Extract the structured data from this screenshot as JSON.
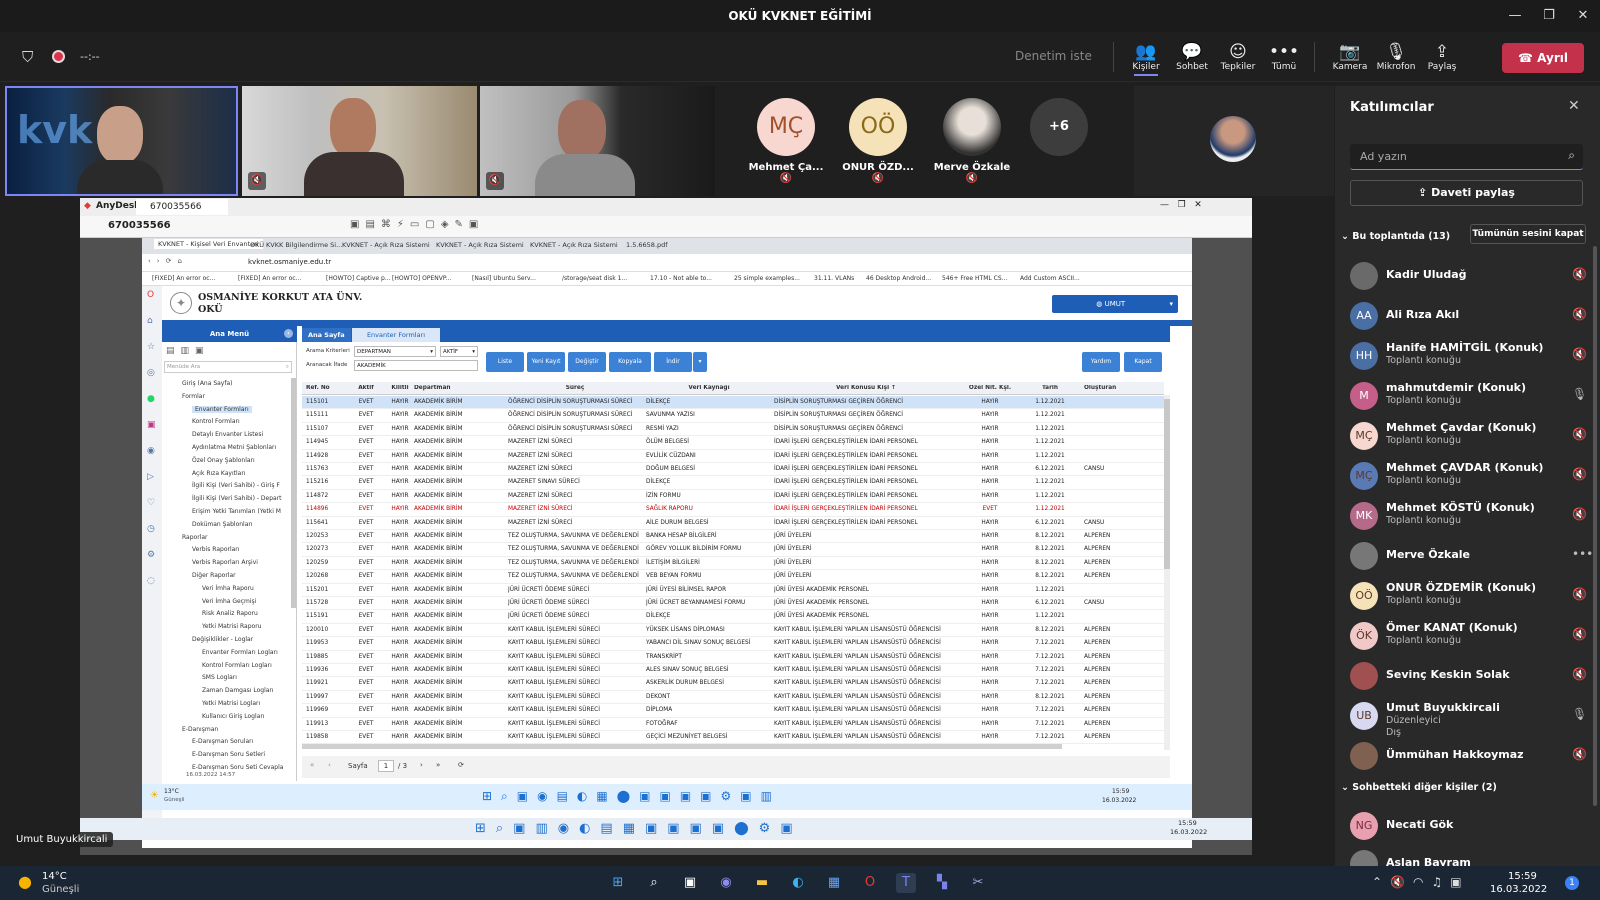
{
  "window": {
    "title": "OKÜ KVKNET EĞİTİMİ"
  },
  "meeting": {
    "timer": "--:--",
    "ask_control": "Denetim iste",
    "tools": [
      "Kişiler",
      "Sohbet",
      "Tepkiler",
      "Tümü",
      "Kamera",
      "Mikrofon",
      "Paylaş"
    ],
    "leave_label": "Ayrıl",
    "avatars": [
      {
        "initials": "MÇ",
        "name": "Mehmet Ça...",
        "color": "#f7d7cf",
        "fg": "#a0522d"
      },
      {
        "initials": "OÖ",
        "name": "ONUR ÖZD...",
        "color": "#f5e2b8",
        "fg": "#8a6a1a"
      },
      {
        "initials": "",
        "name": "Merve Özkale",
        "color": "#888888",
        "fg": "#ffffff"
      }
    ],
    "more_count": "+6",
    "presenter_label": "Umut Buyukkircali"
  },
  "panel": {
    "title": "Katılımcılar",
    "search_placeholder": "Ad yazın",
    "share_invite": "Daveti paylaş",
    "in_meeting": "Bu toplantıda (13)",
    "mute_all": "Tümünün sesini kapat",
    "others": "Sohbetteki diğer kişiler (2)",
    "participants": [
      {
        "initials": "",
        "name": "Kadir Uludağ",
        "sub": "",
        "color": "#6a6a6a"
      },
      {
        "initials": "AA",
        "name": "Ali Rıza Akıl",
        "sub": "",
        "color": "#4a6fa5"
      },
      {
        "initials": "HH",
        "name": "Hanife HAMİTGİL (Konuk)",
        "sub": "Toplantı konuğu",
        "color": "#4a6fa5"
      },
      {
        "initials": "M",
        "name": "mahmutdemir (Konuk)",
        "sub": "Toplantı konuğu",
        "color": "#c55f8a"
      },
      {
        "initials": "MÇ",
        "name": "Mehmet Çavdar (Konuk)",
        "sub": "Toplantı konuğu",
        "color": "#f7d7cf"
      },
      {
        "initials": "MÇ",
        "name": "Mehmet ÇAVDAR (Konuk)",
        "sub": "Toplantı konuğu",
        "color": "#5a7ab5"
      },
      {
        "initials": "MK",
        "name": "Mehmet KÖSTÜ (Konuk)",
        "sub": "Toplantı konuğu",
        "color": "#b56a8a"
      },
      {
        "initials": "",
        "name": "Merve Özkale",
        "sub": "",
        "color": "#777777"
      },
      {
        "initials": "OÖ",
        "name": "ONUR ÖZDEMİR (Konuk)",
        "sub": "Toplantı konuğu",
        "color": "#f5e2b8"
      },
      {
        "initials": "ÖK",
        "name": "Ömer KANAT (Konuk)",
        "sub": "Toplantı konuğu",
        "color": "#f0c8c8"
      },
      {
        "initials": "",
        "name": "Sevinç Keskin Solak",
        "sub": "",
        "color": "#a05050"
      },
      {
        "initials": "UB",
        "name": "Umut Buyukkircali",
        "sub": "Düzenleyici",
        "sub2": "Dış",
        "color": "#d8d8f0"
      },
      {
        "initials": "",
        "name": "Ümmühan Hakkoymaz",
        "sub": "",
        "color": "#806050"
      }
    ],
    "others_list": [
      {
        "initials": "NG",
        "name": "Necati Gök",
        "color": "#e8a0b0"
      },
      {
        "initials": "",
        "name": "Aslan Bayram",
        "color": "#777777"
      }
    ]
  },
  "anydesk": {
    "title": "AnyDesk",
    "tab": "670035566",
    "address": "670035566"
  },
  "browser": {
    "tabs": [
      "KVKNET - Kişisel Veri Envanteri",
      "OKÜ KVKK Bilgilendirme Si...",
      "KVKNET - Açık Rıza Sistemi",
      "KVKNET - Açık Rıza Sistemi",
      "KVKNET - Açık Rıza Sistemi",
      "1.5.6658.pdf"
    ],
    "url": "kvknet.osmaniye.edu.tr",
    "bookmarks": [
      "[FIXED] An error oc...",
      "[FIXED] An error oc...",
      "[HOWTO] Captive p...",
      "[HOWTO] OPENVP...",
      "[Nasıl] Ubuntu Serv...",
      "/storage/seat disk 1...",
      "17.10 - Not able to...",
      "25 simple examples...",
      "31.11. VLANs",
      "46 Desktop Android...",
      "546+ Free HTML CS...",
      "Add Custom ASCII..."
    ]
  },
  "app": {
    "university": "OSMANİYE KORKUT ATA ÜNV.",
    "abbr": "OKÜ",
    "user_button": "UMUT",
    "menu_title": "Ana Menü",
    "menu_search": "Menüde Ara",
    "menu": [
      "Giriş (Ana Sayfa)",
      "Formlar",
      "Envanter Formları",
      "Kontrol Formları",
      "Detaylı Envanter Listesi",
      "Aydınlatma Metni Şablonları",
      "Özel Onay Şablonları",
      "Açık Rıza Kayıtları",
      "İlgili Kişi (Veri Sahibi) - Giriş F",
      "İlgili Kişi (Veri Sahibi) - Depart",
      "Erişim Yetki Tanımları (Yetki M",
      "Doküman Şablonları",
      "Raporlar",
      "Verbis Raporları",
      "Verbis Raporları Arşivi",
      "Diğer Raporlar",
      "Veri İmha Raporu",
      "Veri İmha Geçmişi",
      "Risk Analiz Raporu",
      "Yetki Matrisi Raporu",
      "Değişiklikler - Loglar",
      "Envanter Formları Logları",
      "Kontrol Formları Logları",
      "SMS Logları",
      "Zaman Damgası Logları",
      "Yetki Matrisi Logları",
      "Kullanıcı Giriş Logları",
      "E-Danışman",
      "E-Danışman Soruları",
      "E-Danışman Soru Setleri",
      "E-Danışman Soru Seti Cevapla"
    ],
    "menu_date": "16.03.2022 14:57",
    "tab_home": "Ana Sayfa",
    "tab_forms": "Envanter Formları",
    "criteria_label": "Arama Kriterleri",
    "criteria_value": "DEPARTMAN",
    "status_value": "AKTİF",
    "search_label": "Aranacak İfade",
    "search_value": "AKADEMİK",
    "buttons": [
      "Liste",
      "Yeni Kayıt",
      "Değiştir",
      "Kopyala",
      "İndir"
    ],
    "help": "Yardım",
    "close": "Kapat",
    "columns": [
      "Ref. No",
      "Aktif",
      "Kilitli",
      "Departman",
      "Süreç",
      "Veri Kaynağı",
      "Veri Konusu Kişi ↑",
      "Özel Nit. Kşl.",
      "Tarih",
      "Oluşturan"
    ],
    "rows": [
      [
        "115101",
        "EVET",
        "HAYIR",
        "AKADEMİK BİRİM",
        "ÖĞRENCİ DİSİPLİN SORUŞTURMASI SÜRECİ",
        "DİLEKÇE",
        "DİSİPLİN SORUŞTURMASI GEÇİREN ÖĞRENCİ",
        "HAYIR",
        "1.12.2021",
        ""
      ],
      [
        "115111",
        "EVET",
        "HAYIR",
        "AKADEMİK BİRİM",
        "ÖĞRENCİ DİSİPLİN SORUŞTURMASI SÜRECİ",
        "SAVUNMA YAZISI",
        "DİSİPLİN SORUŞTURMASI GEÇİREN ÖĞRENCİ",
        "HAYIR",
        "1.12.2021",
        ""
      ],
      [
        "115107",
        "EVET",
        "HAYIR",
        "AKADEMİK BİRİM",
        "ÖĞRENCİ DİSİPLİN SORUŞTURMASI SÜRECİ",
        "RESMİ YAZI",
        "DİSİPLİN SORUŞTURMASI GEÇİREN ÖĞRENCİ",
        "HAYIR",
        "1.12.2021",
        ""
      ],
      [
        "114945",
        "EVET",
        "HAYIR",
        "AKADEMİK BİRİM",
        "MAZERET İZNİ SÜRECİ",
        "ÖLÜM BELGESİ",
        "İDARİ İŞLERİ GERÇEKLEŞTİRİLEN İDARİ PERSONEL",
        "HAYIR",
        "1.12.2021",
        ""
      ],
      [
        "114928",
        "EVET",
        "HAYIR",
        "AKADEMİK BİRİM",
        "MAZERET İZNİ SÜRECİ",
        "EVLİLİK CÜZDANI",
        "İDARİ İŞLERİ GERÇEKLEŞTİRİLEN İDARİ PERSONEL",
        "HAYIR",
        "1.12.2021",
        ""
      ],
      [
        "115763",
        "EVET",
        "HAYIR",
        "AKADEMİK BİRİM",
        "MAZERET İZNİ SÜRECİ",
        "DOĞUM BELGESİ",
        "İDARİ İŞLERİ GERÇEKLEŞTİRİLEN İDARİ PERSONEL",
        "HAYIR",
        "6.12.2021",
        "CANSU"
      ],
      [
        "115216",
        "EVET",
        "HAYIR",
        "AKADEMİK BİRİM",
        "MAZERET SINAVI SÜRECİ",
        "DİLEKÇE",
        "İDARİ İŞLERİ GERÇEKLEŞTİRİLEN İDARİ PERSONEL",
        "HAYIR",
        "1.12.2021",
        ""
      ],
      [
        "114872",
        "EVET",
        "HAYIR",
        "AKADEMİK BİRİM",
        "MAZERET İZNİ SÜRECİ",
        "İZİN FORMU",
        "İDARİ İŞLERİ GERÇEKLEŞTİRİLEN İDARİ PERSONEL",
        "HAYIR",
        "1.12.2021",
        ""
      ],
      [
        "114896",
        "EVET",
        "HAYIR",
        "AKADEMİK BİRİM",
        "MAZERET İZNİ SÜRECİ",
        "SAĞLIK RAPORU",
        "İDARİ İŞLERİ GERÇEKLEŞTİRİLEN İDARİ PERSONEL",
        "EVET",
        "1.12.2021",
        ""
      ],
      [
        "115641",
        "EVET",
        "HAYIR",
        "AKADEMİK BİRİM",
        "MAZERET İZNİ SÜRECİ",
        "AİLE DURUM BELGESİ",
        "İDARİ İŞLERİ GERÇEKLEŞTİRİLEN İDARİ PERSONEL",
        "HAYIR",
        "6.12.2021",
        "CANSU"
      ],
      [
        "120253",
        "EVET",
        "HAYIR",
        "AKADEMİK BİRİM",
        "TEZ OLUŞTURMA, SAVUNMA VE DEĞERLENDİ",
        "BANKA HESAP BİLGİLERİ",
        "JÜRİ ÜYELERİ",
        "HAYIR",
        "8.12.2021",
        "ALPEREN"
      ],
      [
        "120273",
        "EVET",
        "HAYIR",
        "AKADEMİK BİRİM",
        "TEZ OLUŞTURMA, SAVUNMA VE DEĞERLENDİ",
        "GÖREV YOLLUK BİLDİRİM FORMU",
        "JÜRİ ÜYELERİ",
        "HAYIR",
        "8.12.2021",
        "ALPEREN"
      ],
      [
        "120259",
        "EVET",
        "HAYIR",
        "AKADEMİK BİRİM",
        "TEZ OLUŞTURMA, SAVUNMA VE DEĞERLENDİ",
        "İLETİŞİM BİLGİLERİ",
        "JÜRİ ÜYELERİ",
        "HAYIR",
        "8.12.2021",
        "ALPEREN"
      ],
      [
        "120268",
        "EVET",
        "HAYIR",
        "AKADEMİK BİRİM",
        "TEZ OLUŞTURMA, SAVUNMA VE DEĞERLENDİ",
        "VEB BEYAN FORMU",
        "JÜRİ ÜYELERİ",
        "HAYIR",
        "8.12.2021",
        "ALPEREN"
      ],
      [
        "115201",
        "EVET",
        "HAYIR",
        "AKADEMİK BİRİM",
        "JÜRİ ÜCRETİ ÖDEME SÜRECİ",
        "JÜRİ ÜYESİ BİLİMSEL RAPOR",
        "JÜRİ ÜYESİ AKADEMİK PERSONEL",
        "HAYIR",
        "1.12.2021",
        ""
      ],
      [
        "115728",
        "EVET",
        "HAYIR",
        "AKADEMİK BİRİM",
        "JÜRİ ÜCRETİ ÖDEME SÜRECİ",
        "JÜRİ ÜCRET BEYANNAMESİ FORMU",
        "JÜRİ ÜYESİ AKADEMİK PERSONEL",
        "HAYIR",
        "6.12.2021",
        "CANSU"
      ],
      [
        "115191",
        "EVET",
        "HAYIR",
        "AKADEMİK BİRİM",
        "JÜRİ ÜCRETİ ÖDEME SÜRECİ",
        "DİLEKÇE",
        "JÜRİ ÜYESİ AKADEMİK PERSONEL",
        "HAYIR",
        "1.12.2021",
        ""
      ],
      [
        "120010",
        "EVET",
        "HAYIR",
        "AKADEMİK BİRİM",
        "KAYIT KABUL İŞLEMLERİ SÜRECİ",
        "YÜKSEK LİSANS DİPLOMASI",
        "KAYIT KABUL İŞLEMLERİ YAPILAN LİSANSÜSTÜ ÖĞRENCİSİ",
        "HAYIR",
        "8.12.2021",
        "ALPEREN"
      ],
      [
        "119953",
        "EVET",
        "HAYIR",
        "AKADEMİK BİRİM",
        "KAYIT KABUL İŞLEMLERİ SÜRECİ",
        "YABANCI DİL SINAV SONUÇ BELGESİ",
        "KAYIT KABUL İŞLEMLERİ YAPILAN LİSANSÜSTÜ ÖĞRENCİSİ",
        "HAYIR",
        "7.12.2021",
        "ALPEREN"
      ],
      [
        "119885",
        "EVET",
        "HAYIR",
        "AKADEMİK BİRİM",
        "KAYIT KABUL İŞLEMLERİ SÜRECİ",
        "TRANSKRİPT",
        "KAYIT KABUL İŞLEMLERİ YAPILAN LİSANSÜSTÜ ÖĞRENCİSİ",
        "HAYIR",
        "7.12.2021",
        "ALPEREN"
      ],
      [
        "119936",
        "EVET",
        "HAYIR",
        "AKADEMİK BİRİM",
        "KAYIT KABUL İŞLEMLERİ SÜRECİ",
        "ALES SINAV SONUÇ BELGESİ",
        "KAYIT KABUL İŞLEMLERİ YAPILAN LİSANSÜSTÜ ÖĞRENCİSİ",
        "HAYIR",
        "7.12.2021",
        "ALPEREN"
      ],
      [
        "119921",
        "EVET",
        "HAYIR",
        "AKADEMİK BİRİM",
        "KAYIT KABUL İŞLEMLERİ SÜRECİ",
        "ASKERLİK DURUM BELGESİ",
        "KAYIT KABUL İŞLEMLERİ YAPILAN LİSANSÜSTÜ ÖĞRENCİSİ",
        "HAYIR",
        "7.12.2021",
        "ALPEREN"
      ],
      [
        "119997",
        "EVET",
        "HAYIR",
        "AKADEMİK BİRİM",
        "KAYIT KABUL İŞLEMLERİ SÜRECİ",
        "DEKONT",
        "KAYIT KABUL İŞLEMLERİ YAPILAN LİSANSÜSTÜ ÖĞRENCİSİ",
        "HAYIR",
        "8.12.2021",
        "ALPEREN"
      ],
      [
        "119969",
        "EVET",
        "HAYIR",
        "AKADEMİK BİRİM",
        "KAYIT KABUL İŞLEMLERİ SÜRECİ",
        "DİPLOMA",
        "KAYIT KABUL İŞLEMLERİ YAPILAN LİSANSÜSTÜ ÖĞRENCİSİ",
        "HAYIR",
        "7.12.2021",
        "ALPEREN"
      ],
      [
        "119913",
        "EVET",
        "HAYIR",
        "AKADEMİK BİRİM",
        "KAYIT KABUL İŞLEMLERİ SÜRECİ",
        "FOTOĞRAF",
        "KAYIT KABUL İŞLEMLERİ YAPILAN LİSANSÜSTÜ ÖĞRENCİSİ",
        "HAYIR",
        "7.12.2021",
        "ALPEREN"
      ],
      [
        "119858",
        "EVET",
        "HAYIR",
        "AKADEMİK BİRİM",
        "KAYIT KABUL İŞLEMLERİ SÜRECİ",
        "GEÇİCİ MEZUNİYET BELGESİ",
        "KAYIT KABUL İŞLEMLERİ YAPILAN LİSANSÜSTÜ ÖĞRENCİSİ",
        "HAYIR",
        "7.12.2021",
        "ALPEREN"
      ]
    ],
    "pager_label": "Sayfa",
    "pager_page": "1",
    "pager_total": "/ 3"
  },
  "remote_taskbar": {
    "weather": "13°C",
    "weather_sub": "Güneşli",
    "time": "15:59",
    "date": "16.03.2022"
  },
  "inner_taskbar": {
    "time": "15:59",
    "date": "16.03.2022"
  },
  "taskbar": {
    "weather": "14°C",
    "weather_sub": "Güneşli",
    "time": "15:59",
    "date": "16.03.2022",
    "notif": "1"
  },
  "colors": {
    "accent": "#6264a7",
    "leave": "#c4314b",
    "app_blue": "#1e5eb6",
    "highlight_row": "#cfe2f7",
    "red_row": "#c00000"
  }
}
